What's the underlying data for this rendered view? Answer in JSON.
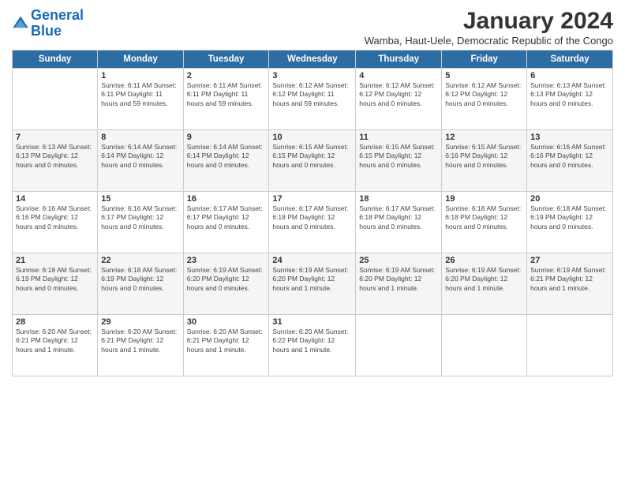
{
  "logo": {
    "text1": "General",
    "text2": "Blue"
  },
  "title": "January 2024",
  "subtitle": "Wamba, Haut-Uele, Democratic Republic of the Congo",
  "days_of_week": [
    "Sunday",
    "Monday",
    "Tuesday",
    "Wednesday",
    "Thursday",
    "Friday",
    "Saturday"
  ],
  "weeks": [
    [
      {
        "day": "",
        "info": ""
      },
      {
        "day": "1",
        "info": "Sunrise: 6:11 AM\nSunset: 6:11 PM\nDaylight: 11 hours\nand 59 minutes."
      },
      {
        "day": "2",
        "info": "Sunrise: 6:11 AM\nSunset: 6:11 PM\nDaylight: 11 hours\nand 59 minutes."
      },
      {
        "day": "3",
        "info": "Sunrise: 6:12 AM\nSunset: 6:12 PM\nDaylight: 11 hours\nand 59 minutes."
      },
      {
        "day": "4",
        "info": "Sunrise: 6:12 AM\nSunset: 6:12 PM\nDaylight: 12 hours\nand 0 minutes."
      },
      {
        "day": "5",
        "info": "Sunrise: 6:12 AM\nSunset: 6:12 PM\nDaylight: 12 hours\nand 0 minutes."
      },
      {
        "day": "6",
        "info": "Sunrise: 6:13 AM\nSunset: 6:13 PM\nDaylight: 12 hours\nand 0 minutes."
      }
    ],
    [
      {
        "day": "7",
        "info": "Sunrise: 6:13 AM\nSunset: 6:13 PM\nDaylight: 12 hours\nand 0 minutes."
      },
      {
        "day": "8",
        "info": "Sunrise: 6:14 AM\nSunset: 6:14 PM\nDaylight: 12 hours\nand 0 minutes."
      },
      {
        "day": "9",
        "info": "Sunrise: 6:14 AM\nSunset: 6:14 PM\nDaylight: 12 hours\nand 0 minutes."
      },
      {
        "day": "10",
        "info": "Sunrise: 6:15 AM\nSunset: 6:15 PM\nDaylight: 12 hours\nand 0 minutes."
      },
      {
        "day": "11",
        "info": "Sunrise: 6:15 AM\nSunset: 6:15 PM\nDaylight: 12 hours\nand 0 minutes."
      },
      {
        "day": "12",
        "info": "Sunrise: 6:15 AM\nSunset: 6:16 PM\nDaylight: 12 hours\nand 0 minutes."
      },
      {
        "day": "13",
        "info": "Sunrise: 6:16 AM\nSunset: 6:16 PM\nDaylight: 12 hours\nand 0 minutes."
      }
    ],
    [
      {
        "day": "14",
        "info": "Sunrise: 6:16 AM\nSunset: 6:16 PM\nDaylight: 12 hours\nand 0 minutes."
      },
      {
        "day": "15",
        "info": "Sunrise: 6:16 AM\nSunset: 6:17 PM\nDaylight: 12 hours\nand 0 minutes."
      },
      {
        "day": "16",
        "info": "Sunrise: 6:17 AM\nSunset: 6:17 PM\nDaylight: 12 hours\nand 0 minutes."
      },
      {
        "day": "17",
        "info": "Sunrise: 6:17 AM\nSunset: 6:18 PM\nDaylight: 12 hours\nand 0 minutes."
      },
      {
        "day": "18",
        "info": "Sunrise: 6:17 AM\nSunset: 6:18 PM\nDaylight: 12 hours\nand 0 minutes."
      },
      {
        "day": "19",
        "info": "Sunrise: 6:18 AM\nSunset: 6:18 PM\nDaylight: 12 hours\nand 0 minutes."
      },
      {
        "day": "20",
        "info": "Sunrise: 6:18 AM\nSunset: 6:19 PM\nDaylight: 12 hours\nand 0 minutes."
      }
    ],
    [
      {
        "day": "21",
        "info": "Sunrise: 6:18 AM\nSunset: 6:19 PM\nDaylight: 12 hours\nand 0 minutes."
      },
      {
        "day": "22",
        "info": "Sunrise: 6:18 AM\nSunset: 6:19 PM\nDaylight: 12 hours\nand 0 minutes."
      },
      {
        "day": "23",
        "info": "Sunrise: 6:19 AM\nSunset: 6:20 PM\nDaylight: 12 hours\nand 0 minutes."
      },
      {
        "day": "24",
        "info": "Sunrise: 6:19 AM\nSunset: 6:20 PM\nDaylight: 12 hours\nand 1 minute."
      },
      {
        "day": "25",
        "info": "Sunrise: 6:19 AM\nSunset: 6:20 PM\nDaylight: 12 hours\nand 1 minute."
      },
      {
        "day": "26",
        "info": "Sunrise: 6:19 AM\nSunset: 6:20 PM\nDaylight: 12 hours\nand 1 minute."
      },
      {
        "day": "27",
        "info": "Sunrise: 6:19 AM\nSunset: 6:21 PM\nDaylight: 12 hours\nand 1 minute."
      }
    ],
    [
      {
        "day": "28",
        "info": "Sunrise: 6:20 AM\nSunset: 6:21 PM\nDaylight: 12 hours\nand 1 minute."
      },
      {
        "day": "29",
        "info": "Sunrise: 6:20 AM\nSunset: 6:21 PM\nDaylight: 12 hours\nand 1 minute."
      },
      {
        "day": "30",
        "info": "Sunrise: 6:20 AM\nSunset: 6:21 PM\nDaylight: 12 hours\nand 1 minute."
      },
      {
        "day": "31",
        "info": "Sunrise: 6:20 AM\nSunset: 6:22 PM\nDaylight: 12 hours\nand 1 minute."
      },
      {
        "day": "",
        "info": ""
      },
      {
        "day": "",
        "info": ""
      },
      {
        "day": "",
        "info": ""
      }
    ]
  ]
}
